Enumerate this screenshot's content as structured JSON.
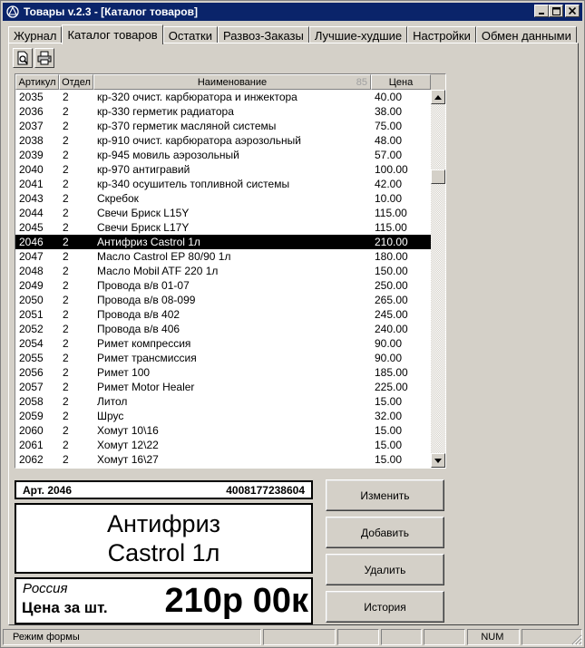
{
  "window": {
    "title": "Товары v.2.3 - [Каталог товаров]",
    "icon": "app-logo-icon",
    "controls": [
      "minimize-icon",
      "maximize-icon",
      "close-icon"
    ]
  },
  "tabs": [
    {
      "label": "Журнал",
      "active": false
    },
    {
      "label": "Каталог товаров",
      "active": true
    },
    {
      "label": "Остатки",
      "active": false
    },
    {
      "label": "Развоз-Заказы",
      "active": false
    },
    {
      "label": "Лучшие-худшие",
      "active": false
    },
    {
      "label": "Настройки",
      "active": false
    },
    {
      "label": "Обмен данными",
      "active": false
    }
  ],
  "toolbar": {
    "preview_icon": "print-preview-icon",
    "print_icon": "printer-icon"
  },
  "grid": {
    "headers": {
      "article": "Артикул",
      "department": "Отдел",
      "name": "Наименование",
      "name_count": "85",
      "price": "Цена"
    },
    "selected_index": 11,
    "rows": [
      {
        "article": "2035",
        "department": "2",
        "name": "кр-320 очист. карбюратора и инжектора",
        "price": "40.00"
      },
      {
        "article": "2036",
        "department": "2",
        "name": "кр-330 герметик  радиатора",
        "price": "38.00"
      },
      {
        "article": "2037",
        "department": "2",
        "name": "кр-370 герметик масляной системы",
        "price": "75.00"
      },
      {
        "article": "2038",
        "department": "2",
        "name": "кр-910 очист. карбюратора аэрозольный",
        "price": "48.00"
      },
      {
        "article": "2039",
        "department": "2",
        "name": "кр-945 мовиль аэрозольный",
        "price": "57.00"
      },
      {
        "article": "2040",
        "department": "2",
        "name": "кр-970 антигравий",
        "price": "100.00"
      },
      {
        "article": "2041",
        "department": "2",
        "name": "кр-340 осушитель топливной системы",
        "price": "42.00"
      },
      {
        "article": "2043",
        "department": "2",
        "name": "Скребок",
        "price": "10.00"
      },
      {
        "article": "2044",
        "department": "2",
        "name": "Свечи Бриск L15Y",
        "price": "115.00"
      },
      {
        "article": "2045",
        "department": "2",
        "name": "Свечи Бриск L17Y",
        "price": "115.00"
      },
      {
        "article": "2046",
        "department": "2",
        "name": "Антифриз Castrol 1л",
        "price": "210.00"
      },
      {
        "article": "2047",
        "department": "2",
        "name": "Масло Castrol EP 80/90 1л",
        "price": "180.00"
      },
      {
        "article": "2048",
        "department": "2",
        "name": "Масло Mobil  ATF 220  1л",
        "price": "150.00"
      },
      {
        "article": "2049",
        "department": "2",
        "name": "Провода в/в 01-07",
        "price": "250.00"
      },
      {
        "article": "2050",
        "department": "2",
        "name": "Провода в/в 08-099",
        "price": "265.00"
      },
      {
        "article": "2051",
        "department": "2",
        "name": "Провода в/в 402",
        "price": "245.00"
      },
      {
        "article": "2052",
        "department": "2",
        "name": "Провода в/в 406",
        "price": "240.00"
      },
      {
        "article": "2054",
        "department": "2",
        "name": "Римет компрессия",
        "price": "90.00"
      },
      {
        "article": "2055",
        "department": "2",
        "name": "Римет трансмиссия",
        "price": "90.00"
      },
      {
        "article": "2056",
        "department": "2",
        "name": "Римет 100",
        "price": "185.00"
      },
      {
        "article": "2057",
        "department": "2",
        "name": "Римет Motor Healer",
        "price": "225.00"
      },
      {
        "article": "2058",
        "department": "2",
        "name": "Литол",
        "price": "15.00"
      },
      {
        "article": "2059",
        "department": "2",
        "name": "Шрус",
        "price": "32.00"
      },
      {
        "article": "2060",
        "department": "2",
        "name": "Хомут  10\\16",
        "price": "15.00"
      },
      {
        "article": "2061",
        "department": "2",
        "name": "Хомут  12\\22",
        "price": "15.00"
      },
      {
        "article": "2062",
        "department": "2",
        "name": "Хомут  16\\27",
        "price": "15.00"
      }
    ]
  },
  "detail": {
    "article_label": "Арт. 2046",
    "barcode": "4008177238604",
    "name_line1": "Антифриз",
    "name_line2": "Castrol 1л",
    "country": "Россия",
    "unit_label": "Цена за шт.",
    "big_price": "210р 00к"
  },
  "buttons": {
    "edit": "Изменить",
    "add": "Добавить",
    "delete": "Удалить",
    "history": "История"
  },
  "status": {
    "mode": "Режим формы",
    "num": "NUM"
  }
}
